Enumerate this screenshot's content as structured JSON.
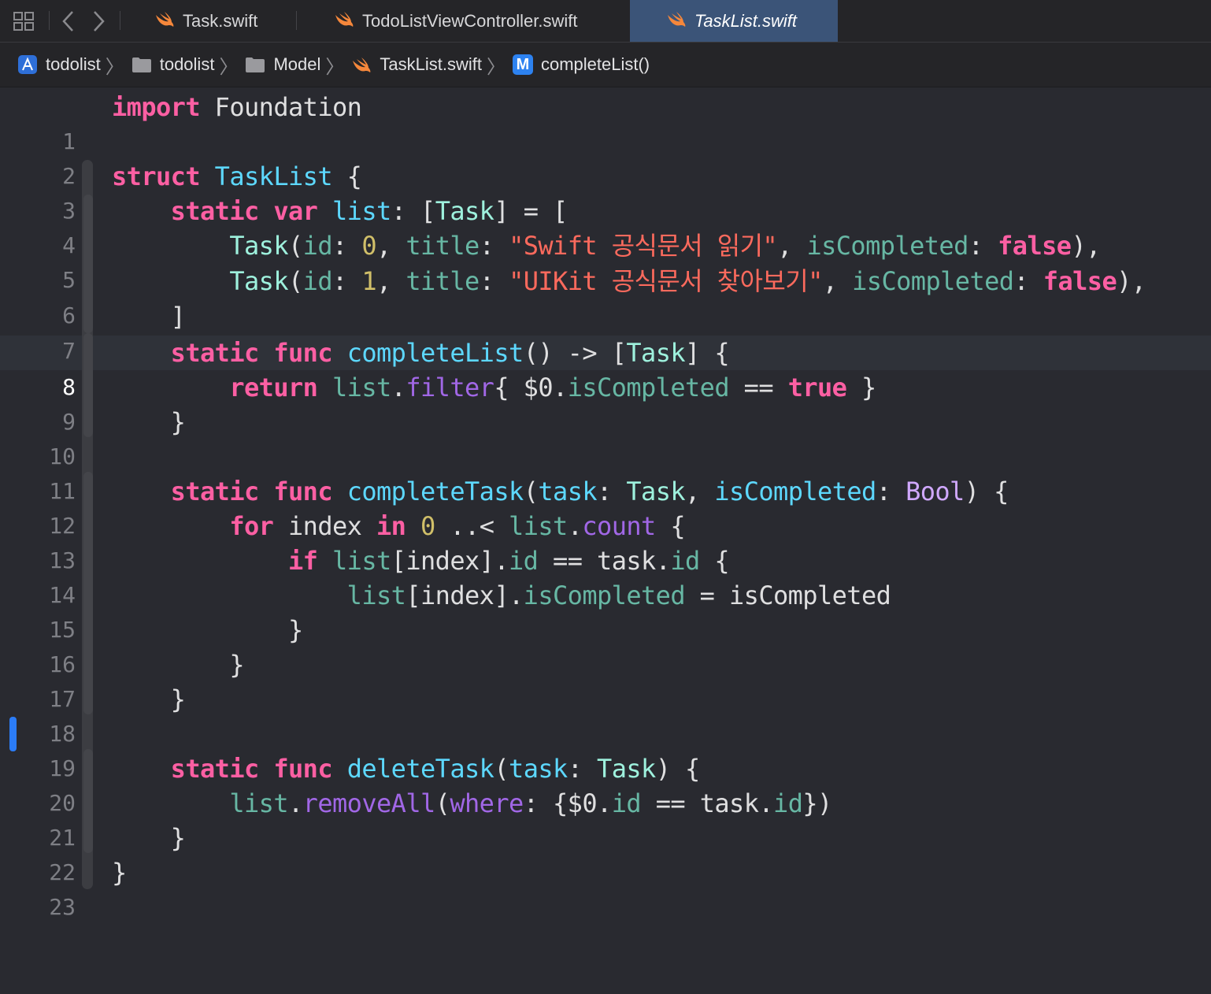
{
  "tabs": [
    {
      "label": "Task.swift",
      "active": false
    },
    {
      "label": "TodoListViewController.swift",
      "active": false
    },
    {
      "label": "TaskList.swift",
      "active": true
    }
  ],
  "breadcrumb": {
    "project": "todolist",
    "folder1": "todolist",
    "folder2": "Model",
    "file": "TaskList.swift",
    "method_badge": "M",
    "method": "completeList()"
  },
  "editor": {
    "current_line": 8,
    "lines": [
      {
        "n": "1",
        "text": "import Foundation"
      },
      {
        "n": "2",
        "text": ""
      },
      {
        "n": "3",
        "text": "struct TaskList {"
      },
      {
        "n": "4",
        "text": "    static var list: [Task] = ["
      },
      {
        "n": "5",
        "text": "        Task(id: 0, title: \"Swift 공식문서 읽기\", isCompleted: false),"
      },
      {
        "n": "6",
        "text": "        Task(id: 1, title: \"UIKit 공식문서 찾아보기\", isCompleted: false),"
      },
      {
        "n": "7",
        "text": "    ]"
      },
      {
        "n": "8",
        "text": "    static func completeList() -> [Task] {"
      },
      {
        "n": "9",
        "text": "        return list.filter{ $0.isCompleted == true }"
      },
      {
        "n": "10",
        "text": "    }"
      },
      {
        "n": "11",
        "text": ""
      },
      {
        "n": "12",
        "text": "    static func completeTask(task: Task, isCompleted: Bool) {"
      },
      {
        "n": "13",
        "text": "        for index in 0 ..< list.count {"
      },
      {
        "n": "14",
        "text": "            if list[index].id == task.id {"
      },
      {
        "n": "15",
        "text": "                list[index].isCompleted = isCompleted"
      },
      {
        "n": "16",
        "text": "            }"
      },
      {
        "n": "17",
        "text": "        }"
      },
      {
        "n": "18",
        "text": "    }"
      },
      {
        "n": "19",
        "text": ""
      },
      {
        "n": "20",
        "text": "    static func deleteTask(task: Task) {"
      },
      {
        "n": "21",
        "text": "        list.removeAll(where: {$0.id == task.id})"
      },
      {
        "n": "22",
        "text": "    }"
      },
      {
        "n": "23",
        "text": "}"
      }
    ]
  },
  "colors": {
    "keyword": "#fc5fa3",
    "type_decl": "#5dd8ff",
    "type_ref": "#9ef1dd",
    "string": "#fc6a5d",
    "number": "#d0bf69",
    "project_member": "#67b7a4",
    "system_member": "#a167e6",
    "active_tab": "#3b5478",
    "change_bar": "#2b7cf7"
  }
}
